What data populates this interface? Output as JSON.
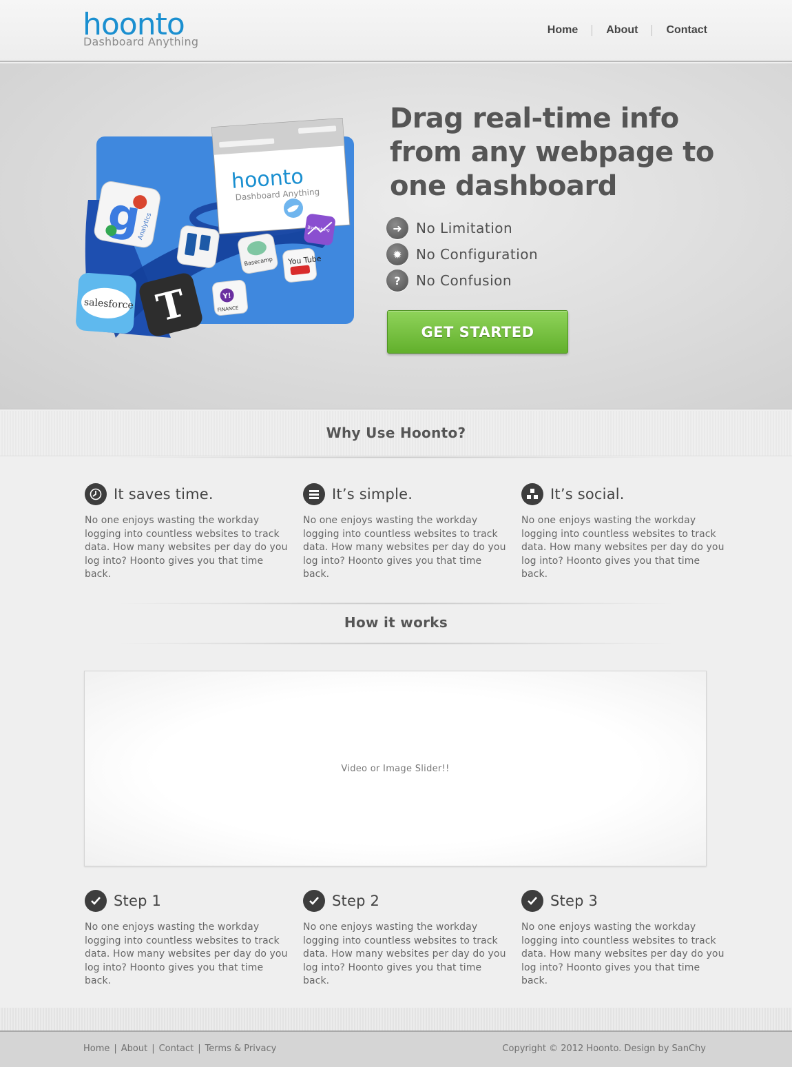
{
  "header": {
    "logo_main": "hoonto",
    "logo_tagline": "Dashboard Anything",
    "nav": [
      "Home",
      "About",
      "Contact"
    ]
  },
  "hero": {
    "title": "Drag real-time info from any webpage to one dashboard",
    "features": [
      {
        "icon": "arrow-right-icon",
        "label": "No Limitation"
      },
      {
        "icon": "gear-icon",
        "label": "No Configuration"
      },
      {
        "icon": "question-icon",
        "label": "No Confusion"
      }
    ],
    "cta_label": "GET STARTED",
    "illustration": {
      "logo_main": "hoonto",
      "logo_tagline": "Dashboard Anything",
      "app_icons": [
        "Analytics",
        "Basecamp",
        "You Tube",
        "salesforce",
        "FINANCE",
        "Bloomberg"
      ]
    }
  },
  "why": {
    "title": "Why Use Hoonto?",
    "items": [
      {
        "icon": "clock-icon",
        "title": "It saves time.",
        "text": "No one enjoys wasting the workday logging into countless websites to track data. How many websites per day do you log into? Hoonto gives you that time back."
      },
      {
        "icon": "list-icon",
        "title": "It’s simple.",
        "text": "No one enjoys wasting the workday logging into countless websites to track data. How many websites per day do you log into? Hoonto gives you that time back."
      },
      {
        "icon": "network-icon",
        "title": "It’s social.",
        "text": "No one enjoys wasting the workday logging into countless websites to track data. How many websites per day do you log into? Hoonto gives you that time back."
      }
    ]
  },
  "how": {
    "title": "How it works",
    "slider_placeholder": "Video or Image Slider!!",
    "steps": [
      {
        "icon": "check-icon",
        "title": "Step 1",
        "text": "No one enjoys wasting the workday logging into countless websites to track data. How many websites per day do you log into? Hoonto gives you that time back."
      },
      {
        "icon": "check-icon",
        "title": "Step 2",
        "text": "No one enjoys wasting the workday logging into countless websites to track data. How many websites per day do you log into? Hoonto gives you that time back."
      },
      {
        "icon": "check-icon",
        "title": "Step 3",
        "text": "No one enjoys wasting the workday logging into countless websites to track data. How many websites per day do you log into? Hoonto gives you that time back."
      }
    ]
  },
  "footer": {
    "links": [
      "Home",
      "About",
      "Contact",
      "Terms & Privacy"
    ],
    "copyright": "Copyright © 2012 Hoonto. Design by SanChy"
  },
  "colors": {
    "brand_blue": "#1a8fd0",
    "cta_green": "#6cbb35",
    "icon_dark": "#3d3d3d"
  }
}
